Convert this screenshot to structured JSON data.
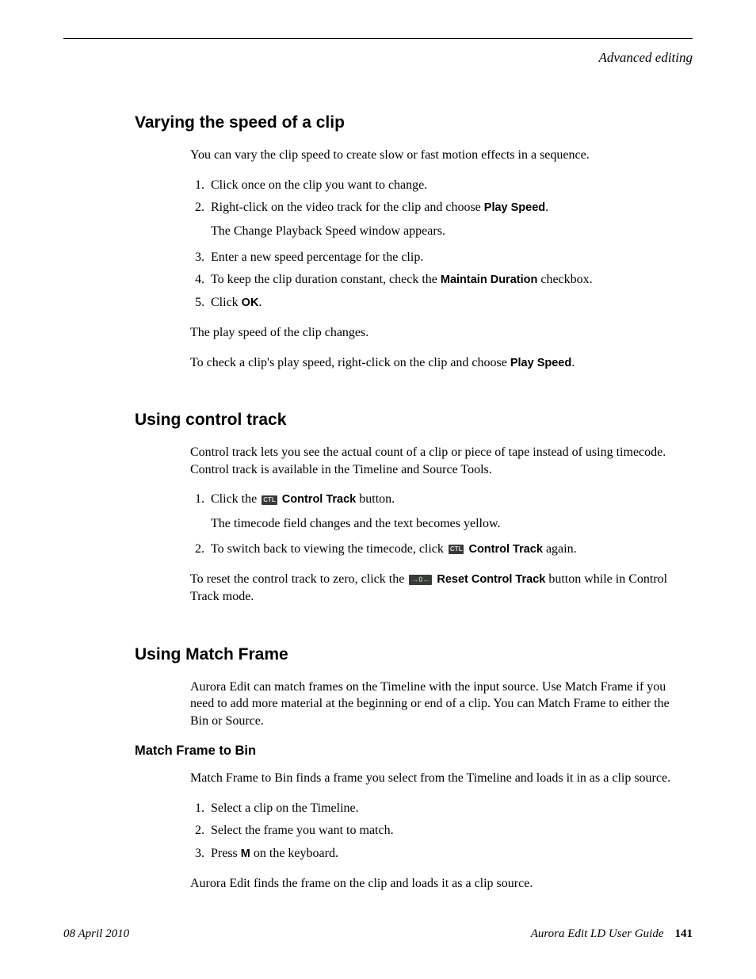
{
  "header": {
    "chapter": "Advanced editing"
  },
  "sections": {
    "varying": {
      "title": "Varying the speed of a clip",
      "intro": "You can vary the clip speed to create slow or fast motion effects in a sequence.",
      "steps": {
        "s1": "Click once on the clip you want to change.",
        "s2a": "Right-click on the video track for the clip and choose ",
        "s2b_bold": "Play Speed",
        "s2c": ".",
        "s2_sub": "The Change Playback Speed window appears.",
        "s3": "Enter a new speed percentage for the clip.",
        "s4a": "To keep the clip duration constant, check the ",
        "s4b_bold": "Maintain Duration",
        "s4c": " checkbox.",
        "s5a": "Click ",
        "s5b_bold": "OK",
        "s5c": "."
      },
      "after1": "The play speed of the clip changes.",
      "after2a": "To check a clip's play speed, right-click on the clip and choose ",
      "after2b_bold": "Play Speed",
      "after2c": "."
    },
    "control": {
      "title": "Using control track",
      "intro": "Control track lets you see the actual count of a clip or piece of tape instead of using timecode. Control track is available in the Timeline and Source Tools.",
      "steps": {
        "s1a": "Click the ",
        "s1_icon": "CTL",
        "s1b_bold": "Control Track",
        "s1c": " button.",
        "s1_sub": "The timecode field changes and the text becomes yellow.",
        "s2a": "To switch back to viewing the timecode, click ",
        "s2_icon": "CTL",
        "s2b_bold": "Control Track",
        "s2c": " again."
      },
      "after1a": "To reset the control track to zero, click the ",
      "after1_icon": "→0←",
      "after1b_bold": "Reset Control Track",
      "after1c": " button while in Control Track mode."
    },
    "match": {
      "title": "Using Match Frame",
      "intro": "Aurora Edit can match frames on the Timeline with the input source. Use Match Frame if you need to add more material at the beginning or end of a clip. You can Match Frame to either the Bin or Source.",
      "sub_title": "Match Frame to Bin",
      "sub_intro": "Match Frame to Bin finds a frame you select from the Timeline and loads it in as a clip source.",
      "steps": {
        "s1": "Select a clip on the Timeline.",
        "s2": "Select the frame you want to match.",
        "s3a": "Press ",
        "s3b_bold": "M",
        "s3c": " on the keyboard."
      },
      "after1": "Aurora Edit finds the frame on the clip and loads it as a clip source."
    }
  },
  "footer": {
    "date": "08 April 2010",
    "guide": "Aurora Edit LD User Guide",
    "page": "141"
  }
}
